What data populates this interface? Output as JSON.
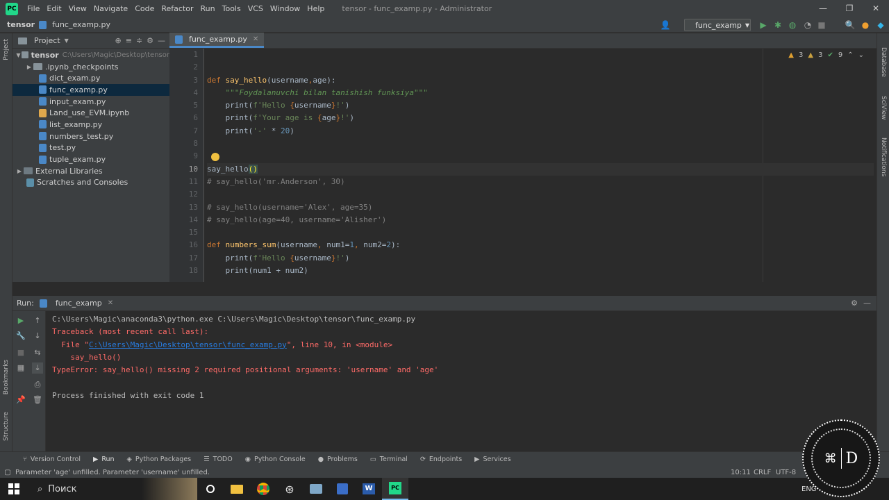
{
  "titlebar": {
    "menu": [
      "File",
      "Edit",
      "View",
      "Navigate",
      "Code",
      "Refactor",
      "Run",
      "Tools",
      "VCS",
      "Window",
      "Help"
    ],
    "window_title": "tensor - func_examp.py - Administrator"
  },
  "navbar": {
    "project": "tensor",
    "file": "func_examp.py",
    "run_config": "func_examp"
  },
  "project_panel": {
    "title": "Project",
    "root": "tensor",
    "root_path": "C:\\Users\\Magic\\Desktop\\tensor",
    "items": [
      {
        "label": ".ipynb_checkpoints",
        "kind": "folder"
      },
      {
        "label": "dict_exam.py",
        "kind": "py"
      },
      {
        "label": "func_examp.py",
        "kind": "py"
      },
      {
        "label": "input_exam.py",
        "kind": "py"
      },
      {
        "label": "Land_use_EVM.ipynb",
        "kind": "nb"
      },
      {
        "label": "list_examp.py",
        "kind": "py"
      },
      {
        "label": "numbers_test.py",
        "kind": "py"
      },
      {
        "label": "test.py",
        "kind": "py"
      },
      {
        "label": "tuple_exam.py",
        "kind": "py"
      }
    ],
    "external": "External Libraries",
    "scratches": "Scratches and Consoles"
  },
  "editor": {
    "tab": "func_examp.py",
    "inspections": {
      "warn": "3",
      "weak": "3",
      "ok": "9"
    },
    "line_numbers": [
      "1",
      "2",
      "3",
      "4",
      "5",
      "6",
      "7",
      "8",
      "9",
      "10",
      "11",
      "12",
      "13",
      "14",
      "15",
      "16",
      "17",
      "18"
    ],
    "current_line": 10
  },
  "run_panel": {
    "label": "Run:",
    "tab": "func_examp",
    "cmd": "C:\\Users\\Magic\\anaconda3\\python.exe C:\\Users\\Magic\\Desktop\\tensor\\func_examp.py",
    "traceback": "Traceback (most recent call last):",
    "file_prefix": "  File \"",
    "file_link": "C:\\Users\\Magic\\Desktop\\tensor\\func_examp.py",
    "file_suffix": "\", line 10, in <module>",
    "call": "    say_hello()",
    "error": "TypeError: say_hello() missing 2 required positional arguments: 'username' and 'age'",
    "finished": "Process finished with exit code 1"
  },
  "bottom_tabs": [
    "Version Control",
    "Run",
    "Python Packages",
    "TODO",
    "Python Console",
    "Problems",
    "Terminal",
    "Endpoints",
    "Services"
  ],
  "status": {
    "message": "Parameter 'age' unfilled. Parameter 'username' unfilled.",
    "position": "10:11",
    "line_sep": "CRLF",
    "encoding": "UTF-8"
  },
  "taskbar": {
    "search": "Поиск",
    "lang": "ENG"
  },
  "side_labels": {
    "project": "Project",
    "bookmarks": "Bookmarks",
    "structure": "Structure",
    "database": "Database",
    "sciview": "SciView",
    "notifications": "Notifications"
  },
  "watermark": {
    "letter": "D"
  }
}
